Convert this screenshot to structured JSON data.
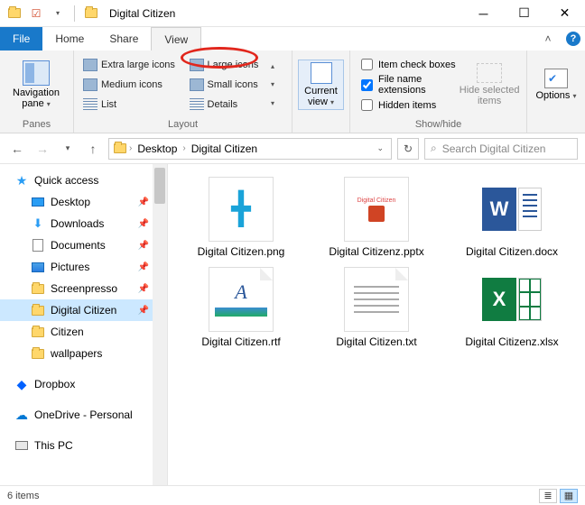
{
  "titlebar": {
    "title": "Digital Citizen"
  },
  "tabs": {
    "file": "File",
    "home": "Home",
    "share": "Share",
    "view": "View"
  },
  "ribbon": {
    "panes": {
      "label": "Panes",
      "navpane": "Navigation pane"
    },
    "layout": {
      "label": "Layout",
      "extra_large": "Extra large icons",
      "large": "Large icons",
      "medium": "Medium icons",
      "small": "Small icons",
      "list": "List",
      "details": "Details"
    },
    "current_view": "Current view",
    "showhide": {
      "label": "Show/hide",
      "item_check": "Item check boxes",
      "file_ext": "File name extensions",
      "hidden": "Hidden items",
      "hide_selected": "Hide selected items"
    },
    "options": "Options"
  },
  "breadcrumb": {
    "a": "Desktop",
    "b": "Digital Citizen"
  },
  "search": {
    "placeholder": "Search Digital Citizen"
  },
  "sidebar": {
    "quick_access": "Quick access",
    "desktop": "Desktop",
    "downloads": "Downloads",
    "documents": "Documents",
    "pictures": "Pictures",
    "screenpresso": "Screenpresso",
    "digital_citizen": "Digital Citizen",
    "citizen": "Citizen",
    "wallpapers": "wallpapers",
    "dropbox": "Dropbox",
    "onedrive": "OneDrive - Personal",
    "this_pc": "This PC"
  },
  "files": {
    "f1": "Digital Citizen.png",
    "f2": "Digital Citizenz.pptx",
    "f3": "Digital Citizen.docx",
    "f4": "Digital Citizen.rtf",
    "f5": "Digital Citizen.txt",
    "f6": "Digital Citizenz.xlsx"
  },
  "status": {
    "count": "6 items"
  }
}
